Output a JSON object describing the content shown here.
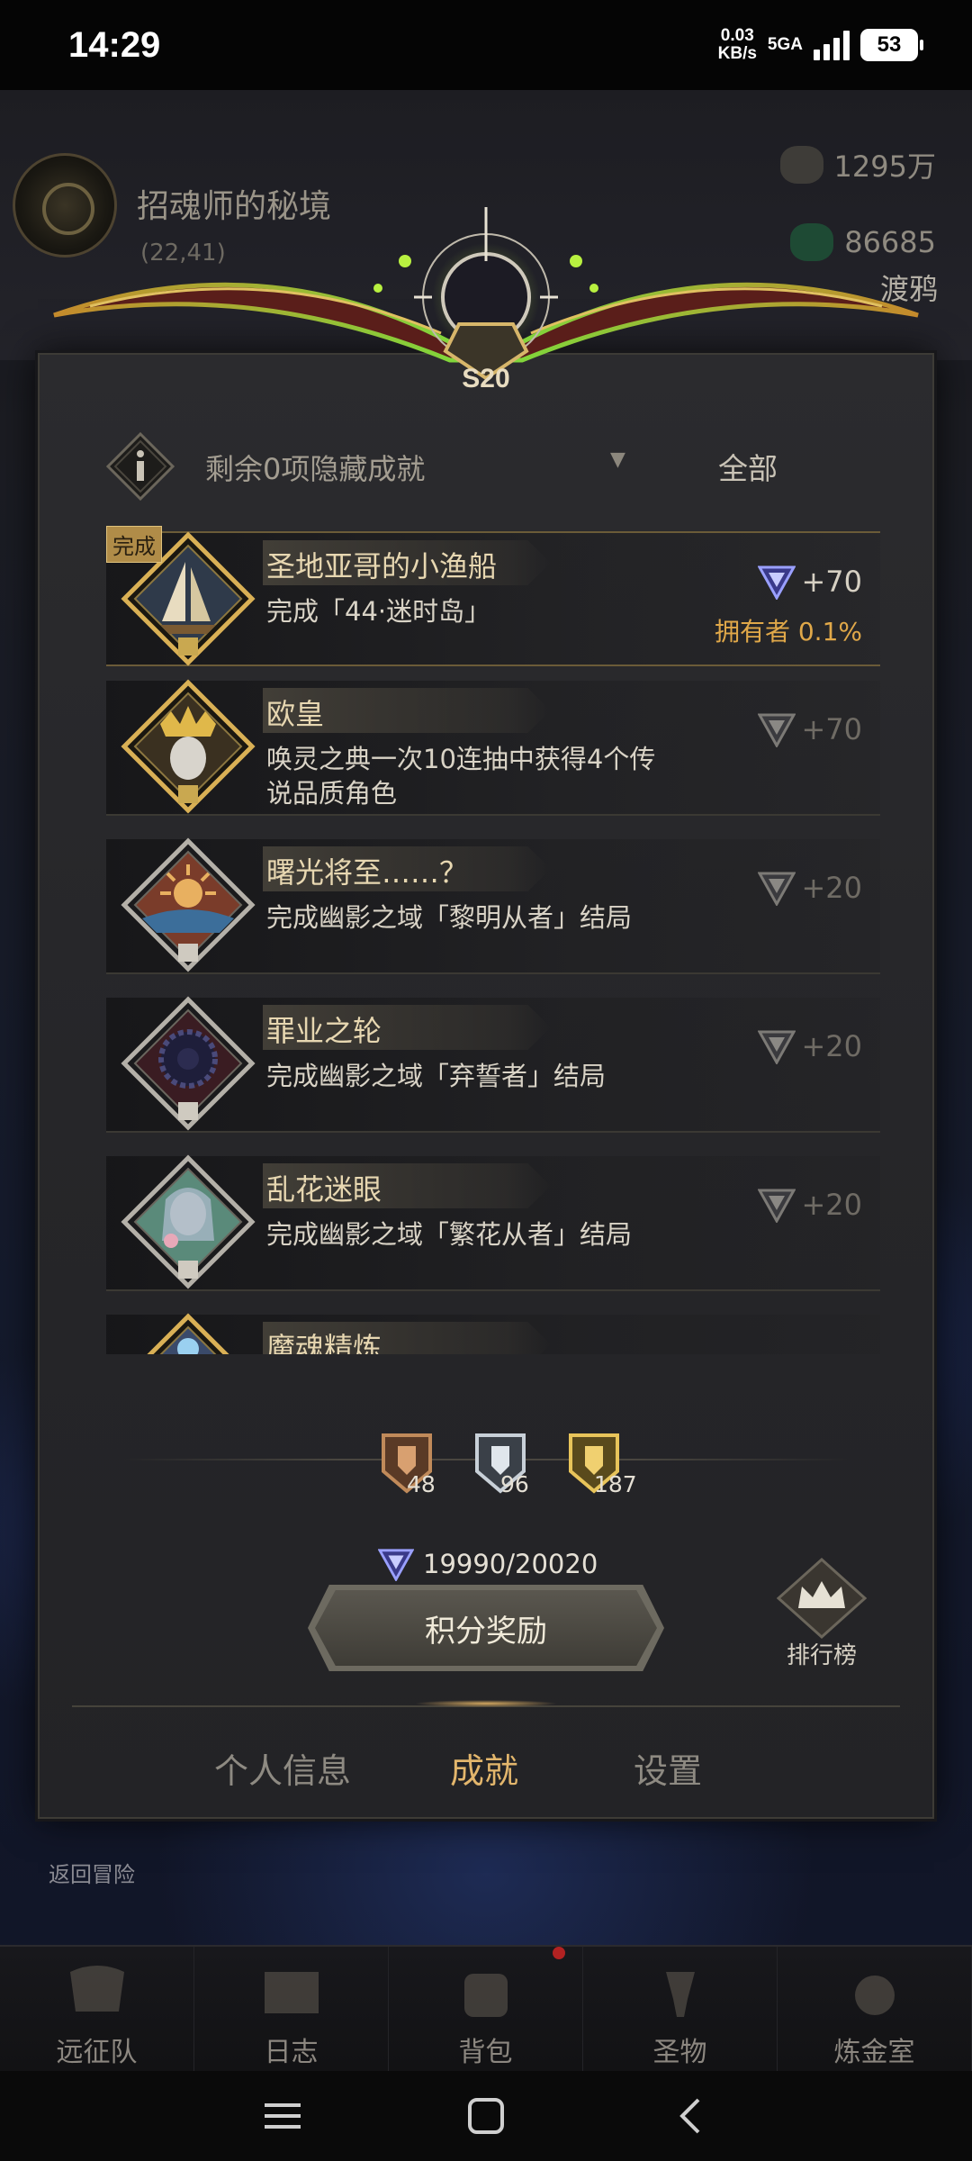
{
  "status_bar": {
    "time": "14:29",
    "net_speed_value": "0.03",
    "net_speed_unit": "KB/s",
    "net_type": "5GA",
    "battery": "53"
  },
  "hud": {
    "location_name": "招魂师的秘境",
    "location_coords": "(22,41)",
    "resource_1": "1295万",
    "resource_2": "86685",
    "resource_tag": "渡鸦"
  },
  "season_badge": "S20",
  "filter": {
    "hidden_label": "剩余0项隐藏成就",
    "dropdown_value": "全部"
  },
  "achievements": [
    {
      "title": "圣地亚哥的小渔船",
      "desc": "完成「44·迷时岛」",
      "points": "+70",
      "done_tag": "完成",
      "owner": "拥有者 0.1%"
    },
    {
      "title": "欧皇",
      "desc": "唤灵之典一次10连抽中获得4个传说品质角色",
      "points": "+70"
    },
    {
      "title": "曙光将至……？",
      "desc": "完成幽影之域「黎明从者」结局",
      "points": "+20"
    },
    {
      "title": "罪业之轮",
      "desc": "完成幽影之域「弃誓者」结局",
      "points": "+20"
    },
    {
      "title": "乱花迷眼",
      "desc": "完成幽影之域「繁花从者」结局",
      "points": "+20"
    },
    {
      "title": "魔魂精炼",
      "desc": "",
      "points": ""
    }
  ],
  "medals": {
    "bronze": "48",
    "silver": "96",
    "gold": "187"
  },
  "score": "19990/20020",
  "reward_button": "积分奖励",
  "rank_label": "排行榜",
  "tabs": {
    "profile": "个人信息",
    "achievements": "成就",
    "settings": "设置"
  },
  "back_to_adventure": "返回冒险",
  "game_nav": [
    "远征队",
    "日志",
    "背包",
    "圣物",
    "炼金室"
  ],
  "colors": {
    "accent_gold": "#e3b66c",
    "owner_orange": "#e0a849",
    "panel_bg": "#2b2b2e"
  }
}
